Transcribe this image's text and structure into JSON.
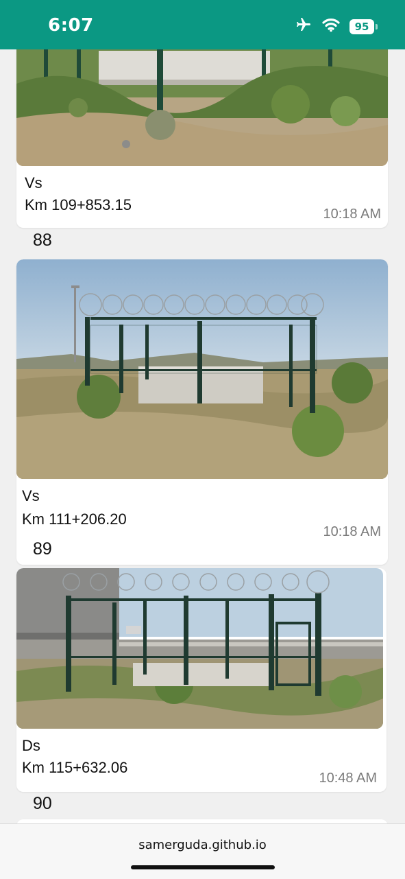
{
  "status_bar": {
    "time": "6:07",
    "battery": "95",
    "icons": [
      "airplane-icon",
      "wifi-icon",
      "battery-icon"
    ]
  },
  "entries": [
    {
      "type": "Vs",
      "km": "Km 109+853.15",
      "time": "10:18 AM",
      "next_number": "88"
    },
    {
      "type": "Vs",
      "km": "Km 111+206.20",
      "time": "10:18 AM",
      "next_number": "89"
    },
    {
      "type": "Ds",
      "km": "Km 115+632.06",
      "time": "10:48 AM",
      "next_number": "90"
    }
  ],
  "browser": {
    "url": "samerguda.github.io"
  },
  "colors": {
    "status_bar": "#0b9883",
    "time_text": "#7a7a7a"
  }
}
